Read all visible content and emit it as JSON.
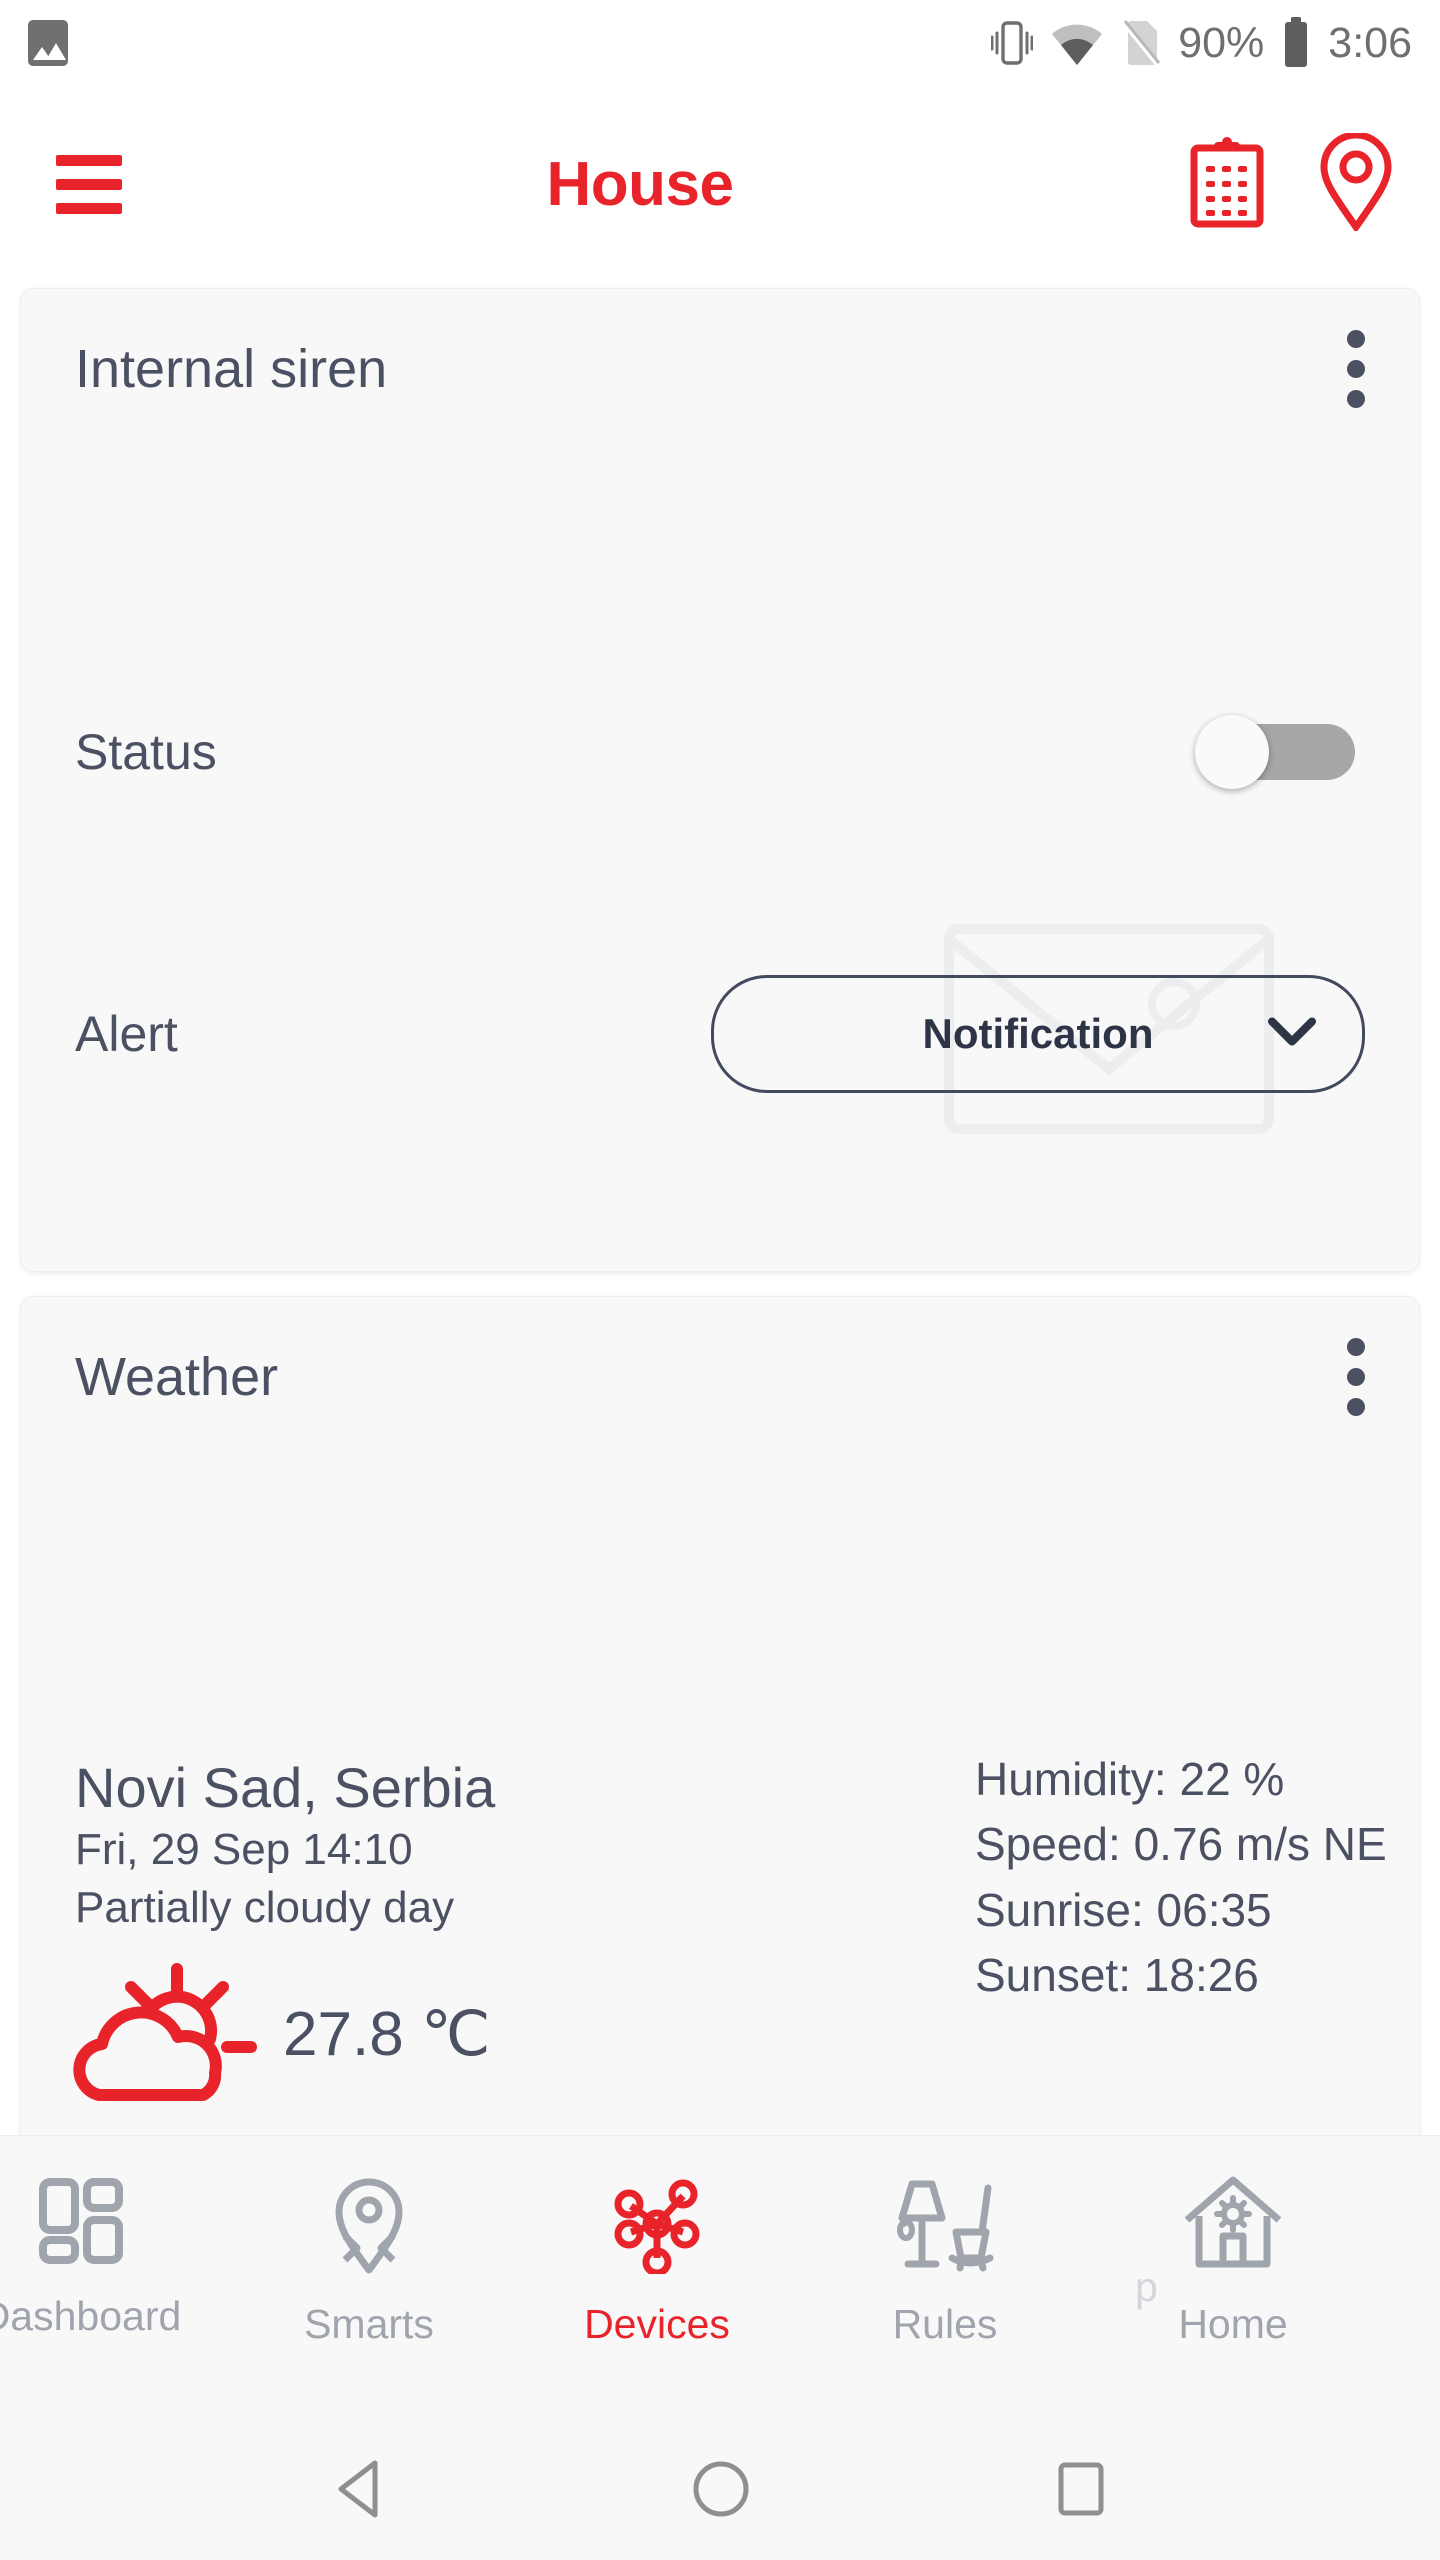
{
  "status_bar": {
    "photo_icon": "photo-icon",
    "vibrate_icon": "vibrate-icon",
    "wifi_icon": "wifi-icon",
    "no_sim_icon": "no-sim-icon",
    "battery_percent": "90%",
    "battery_icon": "battery-icon",
    "clock": "3:06"
  },
  "header": {
    "menu_icon": "hamburger-menu-icon",
    "title": "House",
    "clipboard_icon": "clipboard-icon",
    "location_icon": "location-pin-icon",
    "accent_color": "#e8232a"
  },
  "cards": {
    "siren": {
      "title": "Internal siren",
      "overflow_icon": "more-vertical-icon",
      "status": {
        "label": "Status",
        "toggle_state": "off"
      },
      "alert": {
        "label": "Alert",
        "value": "Notification",
        "chevron_icon": "chevron-down-icon"
      }
    },
    "weather": {
      "title": "Weather",
      "overflow_icon": "more-vertical-icon",
      "city": "Novi Sad, Serbia",
      "datetime": "Fri, 29 Sep 14:10",
      "description": "Partially cloudy day",
      "temperature": "27.8 ℃",
      "condition_icon": "sun-behind-cloud-icon",
      "stats": [
        "Humidity: 22 %",
        "Speed: 0.76 m/s NE",
        "Sunrise: 06:35",
        "Sunset: 18:26"
      ]
    }
  },
  "tabbar": {
    "items": [
      {
        "label": "Dashboard",
        "icon": "dashboard-grid-icon",
        "active": false
      },
      {
        "label": "Smarts",
        "icon": "smart-pin-icon",
        "active": false
      },
      {
        "label": "Devices",
        "icon": "devices-network-icon",
        "active": true
      },
      {
        "label": "Rules",
        "icon": "lamp-chair-icon",
        "active": false
      },
      {
        "label": "Home",
        "icon": "house-gear-icon",
        "active": false
      }
    ],
    "clipped_fragment": "p",
    "active_color": "#e8232a",
    "inactive_color": "#a0a4ad"
  },
  "android_nav": {
    "back_icon": "back-triangle-icon",
    "home_icon": "home-circle-icon",
    "recents_icon": "recents-square-icon"
  }
}
